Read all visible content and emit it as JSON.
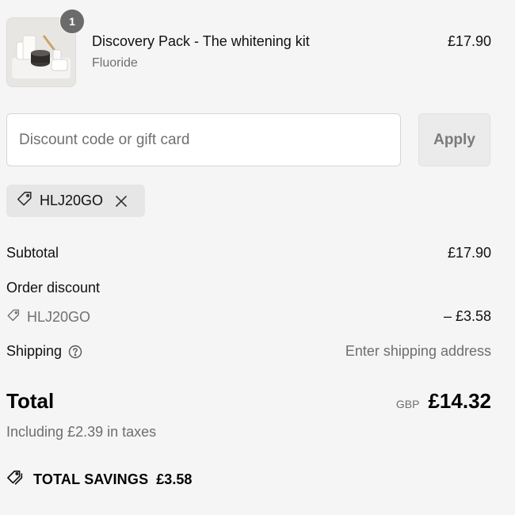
{
  "cart": {
    "item": {
      "title": "Discovery Pack - The whitening kit",
      "variant": "Fluoride",
      "price": "£17.90",
      "quantity": "1"
    }
  },
  "discount": {
    "placeholder": "Discount code or gift card",
    "apply_label": "Apply",
    "applied_code": "HLJ20GO"
  },
  "summary": {
    "subtotal_label": "Subtotal",
    "subtotal_value": "£17.90",
    "order_discount_label": "Order discount",
    "discount_code": "HLJ20GO",
    "discount_value": "– £3.58",
    "shipping_label": "Shipping",
    "shipping_value": "Enter shipping address",
    "total_label": "Total",
    "currency": "GBP",
    "total_value": "£14.32",
    "taxes_note": "Including £2.39 in taxes",
    "savings_label": "TOTAL SAVINGS",
    "savings_value": "£3.58"
  },
  "icons": {
    "tag": "tag-icon",
    "close": "close-icon",
    "help": "question-circle-icon",
    "savings": "tags-icon"
  }
}
